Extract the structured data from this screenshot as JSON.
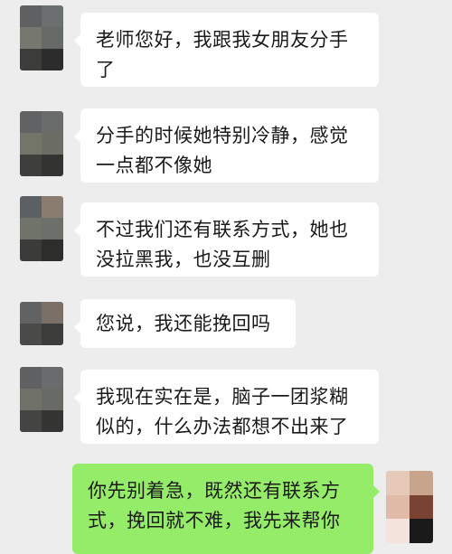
{
  "chat": {
    "messages": [
      {
        "sender": "other",
        "text": "老师您好，我跟我女朋友分手\n了"
      },
      {
        "sender": "other",
        "text": "分手的时候她特别冷静，感觉\n一点都不像她"
      },
      {
        "sender": "other",
        "text": "不过我们还有联系方式，她也\n没拉黑我，也没互删"
      },
      {
        "sender": "other",
        "text": "您说，我还能挽回吗"
      },
      {
        "sender": "other",
        "text": "我现在实在是，脑子一团浆糊\n似的，什么办法都想不出来了"
      },
      {
        "sender": "self",
        "text": "你先别着急，既然还有联系方\n式，挽回就不难，我先来帮你"
      }
    ]
  },
  "colors": {
    "background": "#ededed",
    "bubble_other": "#ffffff",
    "bubble_self": "#95ec69",
    "text": "#1a1a1a"
  },
  "icons": {
    "other_avatar": "avatar-blurred",
    "self_avatar": "avatar-blurred"
  }
}
